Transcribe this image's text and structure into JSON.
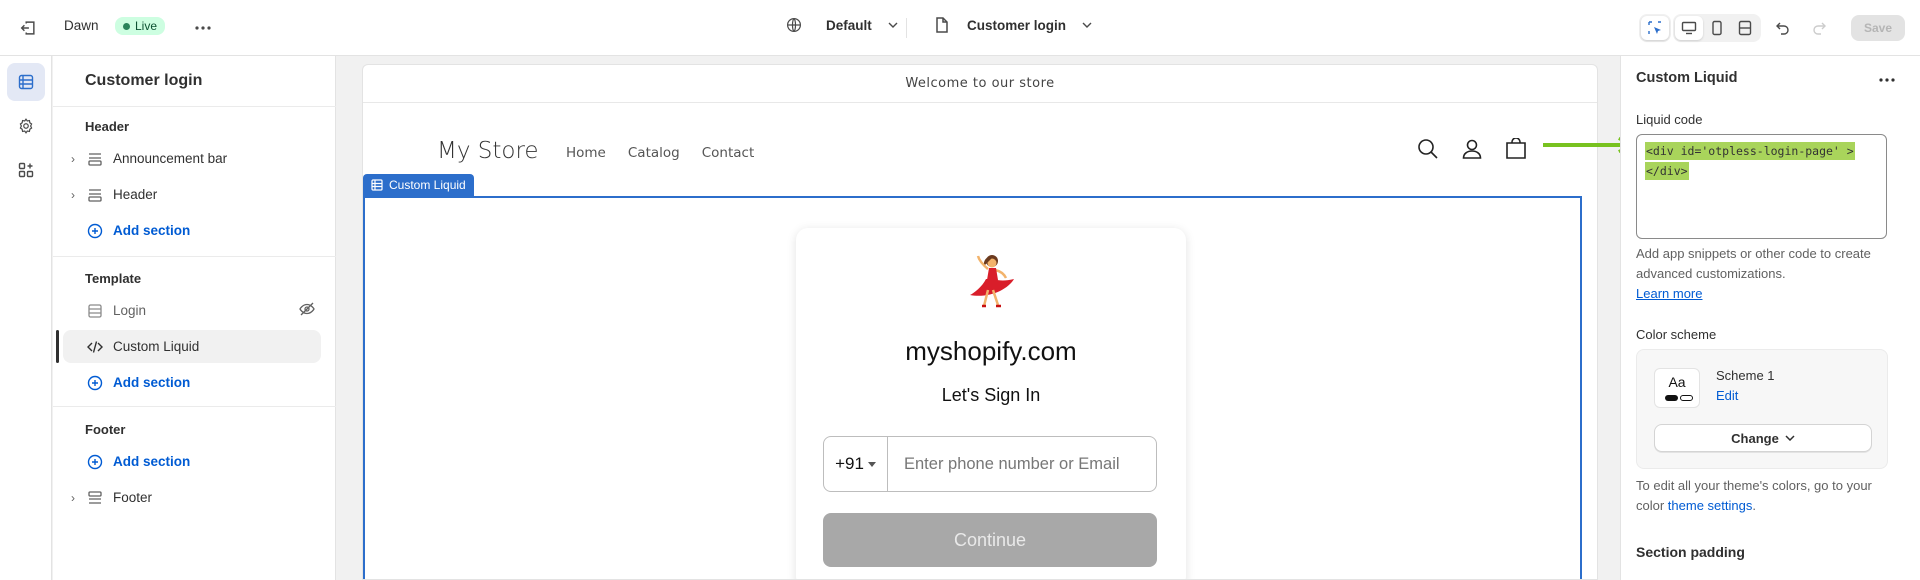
{
  "topbar": {
    "theme_name": "Dawn",
    "live_label": "Live",
    "locale_label": "Default",
    "page_label": "Customer login",
    "save_label": "Save"
  },
  "left_panel": {
    "title": "Customer login",
    "header_group": "Header",
    "header_items": [
      "Announcement bar",
      "Header"
    ],
    "add_section_label": "Add section",
    "template_group": "Template",
    "template_items": [
      "Login",
      "Custom Liquid"
    ],
    "footer_group": "Footer",
    "footer_items": [
      "Footer"
    ]
  },
  "preview": {
    "announcement": "Welcome to our store",
    "store_name": "My Store",
    "nav": [
      "Home",
      "Catalog",
      "Contact"
    ],
    "section_tag": "Custom Liquid",
    "login": {
      "domain": "myshopify.com",
      "subtitle": "Let's Sign In",
      "country_code": "+91",
      "phone_placeholder": "Enter phone number or Email",
      "continue_label": "Continue"
    }
  },
  "right_panel": {
    "title": "Custom Liquid",
    "liquid_code_label": "Liquid code",
    "liquid_code_line1": "<div id='otpless-login-page' >",
    "liquid_code_line2": "</div>",
    "help_text": "Add app snippets or other code to create advanced customizations.",
    "learn_more": "Learn more",
    "color_scheme_label": "Color scheme",
    "scheme_swatch": "Aa",
    "scheme_name": "Scheme 1",
    "scheme_edit": "Edit",
    "change_label": "Change",
    "theme_colors_text": "To edit all your theme's colors, go to your color ",
    "theme_settings_link": "theme settings",
    "section_padding": "Section padding"
  },
  "colors": {
    "accent_blue": "#2c6ecb",
    "link_blue": "#005bd3",
    "highlight_green": "#a9d45b",
    "arrow_green": "#78c21f"
  }
}
